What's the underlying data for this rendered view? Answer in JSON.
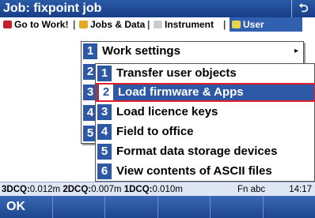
{
  "title": "Job: fixpoint job",
  "close_symbol": "⮌",
  "menubar": {
    "items": [
      {
        "label": "Go to Work!",
        "icon": "go-to-work-icon"
      },
      {
        "label": "Jobs & Data",
        "icon": "jobs-data-icon"
      },
      {
        "label": "Instrument",
        "icon": "instrument-icon"
      },
      {
        "label": "User",
        "icon": "user-icon"
      }
    ],
    "separator": "|"
  },
  "menu1": {
    "items": [
      {
        "num": "1",
        "label": "Work settings",
        "has_submenu": true
      },
      {
        "num": "2",
        "label": ""
      },
      {
        "num": "3",
        "label": ""
      },
      {
        "num": "4",
        "label": ""
      },
      {
        "num": "5",
        "label": ""
      }
    ],
    "submenu_arrow": "▸"
  },
  "menu2": {
    "items": [
      {
        "num": "1",
        "label": "Transfer user objects"
      },
      {
        "num": "2",
        "label": "Load firmware & Apps",
        "highlighted": true
      },
      {
        "num": "3",
        "label": "Load licence keys"
      },
      {
        "num": "4",
        "label": "Field to office"
      },
      {
        "num": "5",
        "label": "Format data storage devices"
      },
      {
        "num": "6",
        "label": "View contents of ASCII files"
      }
    ]
  },
  "statusbar": {
    "q3d_label": "3DCQ:",
    "q3d_value": "0.012m",
    "q2d_label": "2DCQ:",
    "q2d_value": "0.007m",
    "q1d_label": "1DCQ:",
    "q1d_value": "0.010m",
    "fn": "Fn",
    "input_mode": "abc",
    "time": "14:17"
  },
  "softkeys": {
    "f1": "OK",
    "f2": "",
    "f3": "",
    "f4": "",
    "f5": "",
    "f6": ""
  },
  "colors": {
    "accent_blue": "#2d58a5",
    "highlight_border": "#e21f2b"
  }
}
